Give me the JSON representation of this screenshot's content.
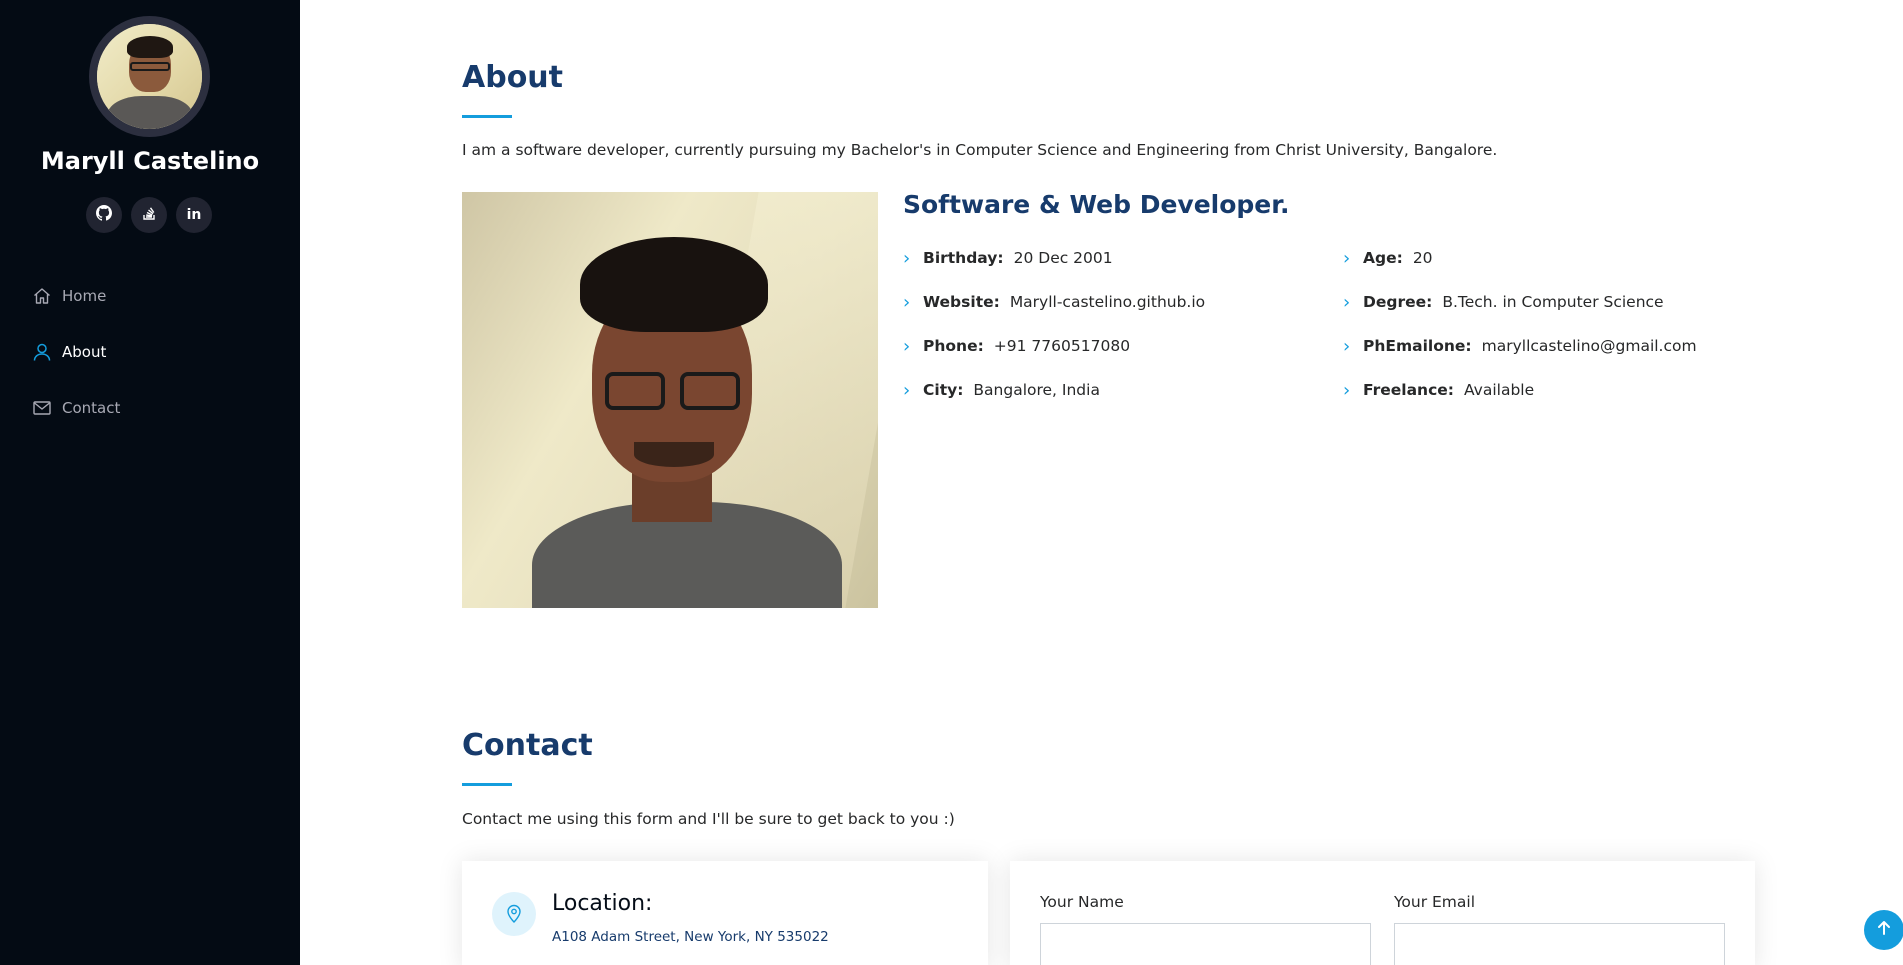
{
  "sidebar": {
    "name": "Maryll Castelino",
    "socials": [
      {
        "label": "",
        "icon": "github-icon"
      },
      {
        "label": "",
        "icon": "stack-overflow-icon"
      },
      {
        "label": "in",
        "icon": "linkedin-icon"
      }
    ],
    "nav": [
      {
        "label": "Home",
        "icon": "home-icon",
        "active": false
      },
      {
        "label": "About",
        "icon": "person-icon",
        "active": true
      },
      {
        "label": "Contact",
        "icon": "envelope-icon",
        "active": false
      }
    ]
  },
  "about": {
    "title": "About",
    "intro": "I am a software developer, currently pursuing my Bachelor's in Computer Science and Engineering from Christ University, Bangalore.",
    "subtitle": "Software & Web Developer.",
    "left_info": [
      {
        "label": "Birthday:",
        "value": "20 Dec 2001"
      },
      {
        "label": "Website:",
        "value": "Maryll-castelino.github.io"
      },
      {
        "label": "Phone:",
        "value": "+91 7760517080"
      },
      {
        "label": "City:",
        "value": "Bangalore, India"
      }
    ],
    "right_info": [
      {
        "label": "Age:",
        "value": "20"
      },
      {
        "label": "Degree:",
        "value": "B.Tech. in Computer Science"
      },
      {
        "label": "PhEmailone:",
        "value": "maryllcastelino@gmail.com"
      },
      {
        "label": "Freelance:",
        "value": "Available"
      }
    ]
  },
  "contact": {
    "title": "Contact",
    "intro": "Contact me using this form and I'll be sure to get back to you :)",
    "location_title": "Location:",
    "location_text": "A108 Adam Street, New York, NY 535022",
    "form": {
      "name_label": "Your Name",
      "email_label": "Your Email",
      "name_value": "",
      "email_value": ""
    }
  },
  "colors": {
    "accent": "#149ddd",
    "heading": "#173b6c",
    "sidebar_bg": "#040b14"
  }
}
